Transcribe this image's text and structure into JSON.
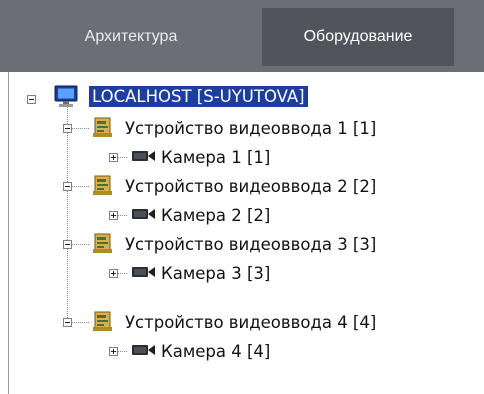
{
  "tabs": [
    {
      "label": "Архитектура"
    },
    {
      "label": "Оборудование",
      "active": true
    }
  ],
  "tree": {
    "root": {
      "label": "LOCALHOST [S-UYUTOVA]",
      "icon": "monitor-icon",
      "selected": true
    },
    "devices": [
      {
        "label": "Устройство видеоввода 1 [1]",
        "icon": "video-capture-board-icon",
        "camera": {
          "label": "Камера 1 [1]",
          "icon": "camera-icon"
        }
      },
      {
        "label": "Устройство видеоввода 2 [2]",
        "icon": "video-capture-board-icon",
        "camera": {
          "label": "Камера 2 [2]",
          "icon": "camera-icon"
        }
      },
      {
        "label": "Устройство видеоввода 3 [3]",
        "icon": "video-capture-board-icon",
        "camera": {
          "label": "Камера 3 [3]",
          "icon": "camera-icon"
        }
      },
      {
        "label": "Устройство видеоввода 4 [4]",
        "icon": "video-capture-board-icon",
        "camera": {
          "label": "Камера 4 [4]",
          "icon": "camera-icon"
        }
      }
    ]
  },
  "colors": {
    "tabbar": "#6b6f75",
    "active_tab": "#51555b",
    "selection": "#1e3e9e"
  }
}
